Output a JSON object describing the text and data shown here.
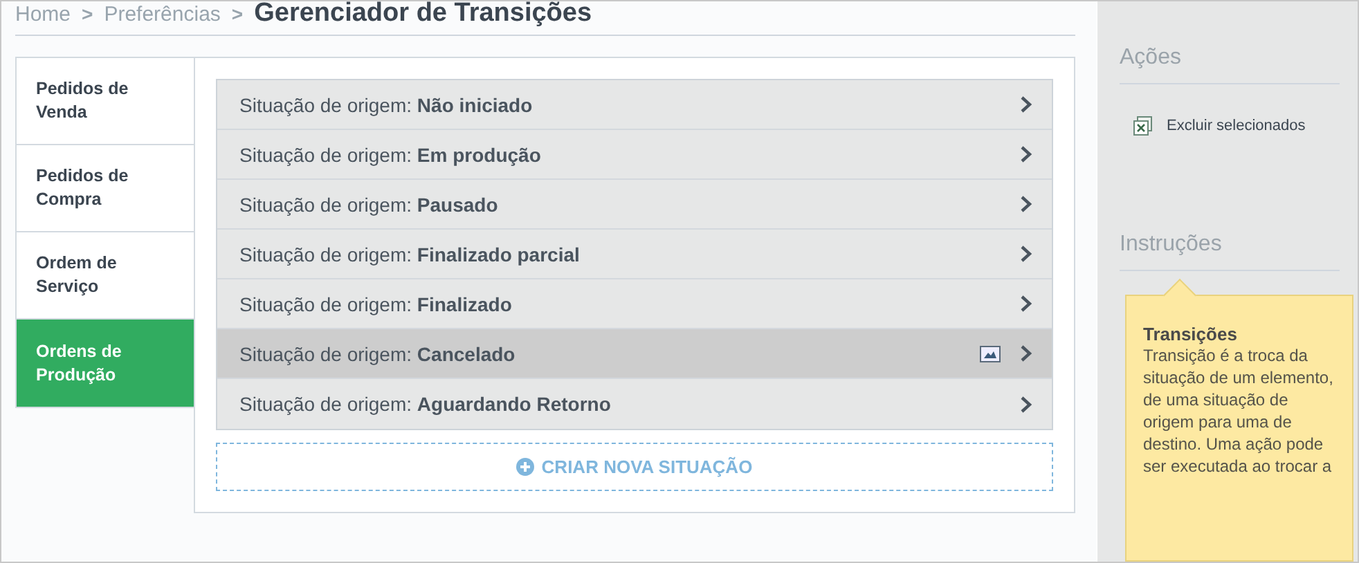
{
  "breadcrumb": {
    "items": [
      "Home",
      "Preferências"
    ],
    "separator": ">",
    "title": "Gerenciador de Transições"
  },
  "tabs": [
    {
      "label": "Pedidos de Venda",
      "selected": false
    },
    {
      "label": "Pedidos de Compra",
      "selected": false
    },
    {
      "label": "Ordem de Serviço",
      "selected": false
    },
    {
      "label": "Ordens de Produção",
      "selected": true
    }
  ],
  "rows": [
    {
      "prefix": "Situação de origem:",
      "status": "Não iniciado",
      "highlighted": false
    },
    {
      "prefix": "Situação de origem:",
      "status": "Em produção",
      "highlighted": false
    },
    {
      "prefix": "Situação de origem:",
      "status": "Pausado",
      "highlighted": false
    },
    {
      "prefix": "Situação de origem:",
      "status": "Finalizado parcial",
      "highlighted": false
    },
    {
      "prefix": "Situação de origem:",
      "status": "Finalizado",
      "highlighted": false
    },
    {
      "prefix": "Situação de origem:",
      "status": "Cancelado",
      "highlighted": true
    },
    {
      "prefix": "Situação de origem:",
      "status": "Aguardando Retorno",
      "highlighted": false
    }
  ],
  "create_button": "CRIAR NOVA SITUAÇÃO",
  "sidebar": {
    "actions_title": "Ações",
    "actions": [
      "Excluir selecionados"
    ],
    "instructions_title": "Instruções",
    "note": {
      "title": "Transições",
      "lines": [
        "Transição é a troca da",
        "situação de um elemento,",
        "de uma situação de",
        "origem para uma de",
        "destino. Uma ação pode",
        "ser executada ao trocar a"
      ]
    }
  }
}
